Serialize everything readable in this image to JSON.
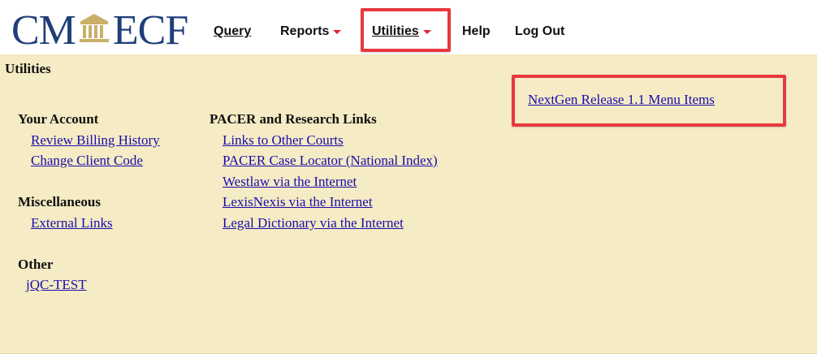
{
  "app": {
    "logo_left": "CM",
    "logo_right": "ECF"
  },
  "menu": {
    "query": "Query",
    "reports": "Reports",
    "utilities": "Utilities",
    "help": "Help",
    "logout": "Log Out"
  },
  "page": {
    "title": "Utilities",
    "nextgen_link": "NextGen Release 1.1 Menu Items"
  },
  "sections": {
    "your_account": {
      "heading": "Your Account",
      "links": [
        "Review Billing History",
        "Change Client Code"
      ]
    },
    "miscellaneous": {
      "heading": "Miscellaneous",
      "links": [
        "External Links"
      ]
    },
    "other": {
      "heading": "Other",
      "links": [
        "jQC-TEST"
      ]
    },
    "pacer": {
      "heading": "PACER and Research Links",
      "links": [
        "Links to Other Courts",
        "PACER Case Locator (National Index)",
        "Westlaw via the Internet",
        "LexisNexis via the Internet",
        "Legal Dictionary via the Internet"
      ]
    }
  },
  "colors": {
    "content_bg": "#f5ebc4",
    "link": "#1a0dab",
    "logo": "#1f3e7a",
    "highlight": "#e8383f",
    "caret": "#e8202f"
  },
  "icons": {
    "logo_building": "courthouse-building-icon",
    "dropdown": "caret-down-icon"
  }
}
